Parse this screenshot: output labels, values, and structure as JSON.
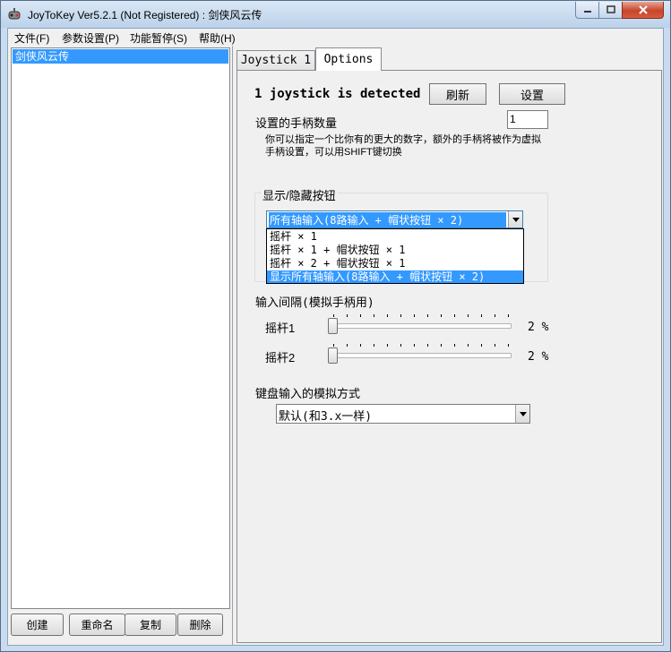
{
  "window": {
    "title": "JoyToKey Ver5.2.1 (Not Registered) : 剑侠风云传"
  },
  "menu": [
    "文件(F)",
    "参数设置(P)",
    "功能暂停(S)",
    "帮助(H)"
  ],
  "configs": {
    "items": [
      "剑侠风云传"
    ],
    "selected_index": 0
  },
  "left_buttons": {
    "create": "创建",
    "rename": "重命名",
    "copy": "复制",
    "delete": "删除"
  },
  "tabs": [
    "Joystick 1",
    "Options"
  ],
  "active_tab": "Options",
  "options": {
    "detected_text": "1 joystick is detected",
    "refresh_label": "刷新",
    "settings_label": "设置",
    "joystick_count_label": "设置的手柄数量",
    "joystick_count_value": "1",
    "hint_line1": "你可以指定一个比你有的更大的数字，额外的手柄将被作为虚拟",
    "hint_line2": "手柄设置，可以用SHIFT键切换",
    "show_hide_group_label": "显示/隐藏按钮",
    "combo_value": "所有轴输入(8路输入 + 帽状按钮 × 2)",
    "combo_options": [
      "摇杆 × 1",
      "摇杆 × 1 + 帽状按钮 × 1",
      "摇杆 × 2 + 帽状按钮 × 1",
      "显示所有轴输入(8路输入 + 帽状按钮 × 2)"
    ],
    "combo_highlighted_index": 3,
    "interval_label": "输入间隔(模拟手柄用)",
    "stick1_label": "摇杆1",
    "stick1_value": "2 %",
    "stick1_level_percent": 2,
    "stick2_label": "摇杆2",
    "stick2_value": "2 %",
    "stick2_level_percent": 2,
    "keyboard_mode_label": "键盘输入的模拟方式",
    "keyboard_mode_value": "默认(和3.x一样)"
  },
  "colors": {
    "selection": "#3399ff",
    "close_button": "#c7452d"
  },
  "icons": [
    "joytokey-app-icon",
    "minimize-icon",
    "maximize-icon",
    "close-icon",
    "dropdown-arrow-icon"
  ]
}
